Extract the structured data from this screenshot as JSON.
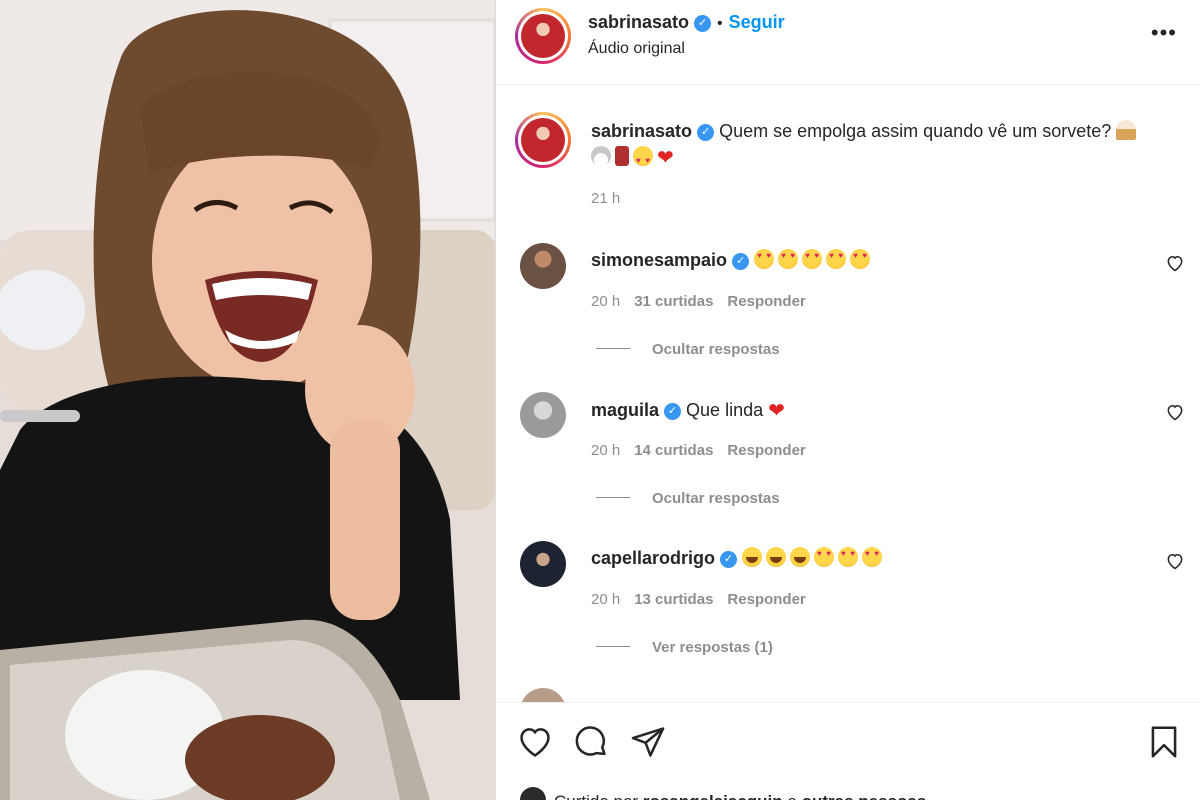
{
  "post": {
    "username": "sabrinasato",
    "follow_label": "Seguir",
    "separator": "•",
    "audio": "Áudio original",
    "more_icon": "more-options-icon"
  },
  "caption": {
    "username": "sabrinasato",
    "text": "Quem se empolga assim quando vê um sorvete?",
    "time": "21 h"
  },
  "comments": [
    {
      "username": "simonesampaio",
      "text": "",
      "time": "20 h",
      "likes": "31 curtidas",
      "reply_label": "Responder",
      "replies_label": "Ocultar respostas"
    },
    {
      "username": "maguila",
      "text": "Que linda",
      "time": "20 h",
      "likes": "14 curtidas",
      "reply_label": "Responder",
      "replies_label": "Ocultar respostas"
    },
    {
      "username": "capellarodrigo",
      "text": "",
      "time": "20 h",
      "likes": "13 curtidas",
      "reply_label": "Responder",
      "replies_label": "Ver respostas (1)"
    }
  ],
  "liked_by": {
    "prefix": "Curtido por",
    "user": "rosangelajacquin",
    "conj": "e",
    "others": "outras pessoas"
  },
  "icons": [
    "like-icon",
    "comment-icon",
    "share-icon",
    "save-icon",
    "verified-icon",
    "heart-outline-icon"
  ],
  "colors": {
    "accent": "#0095f6",
    "verified": "#3897f0",
    "muted": "#8e8e8e"
  }
}
